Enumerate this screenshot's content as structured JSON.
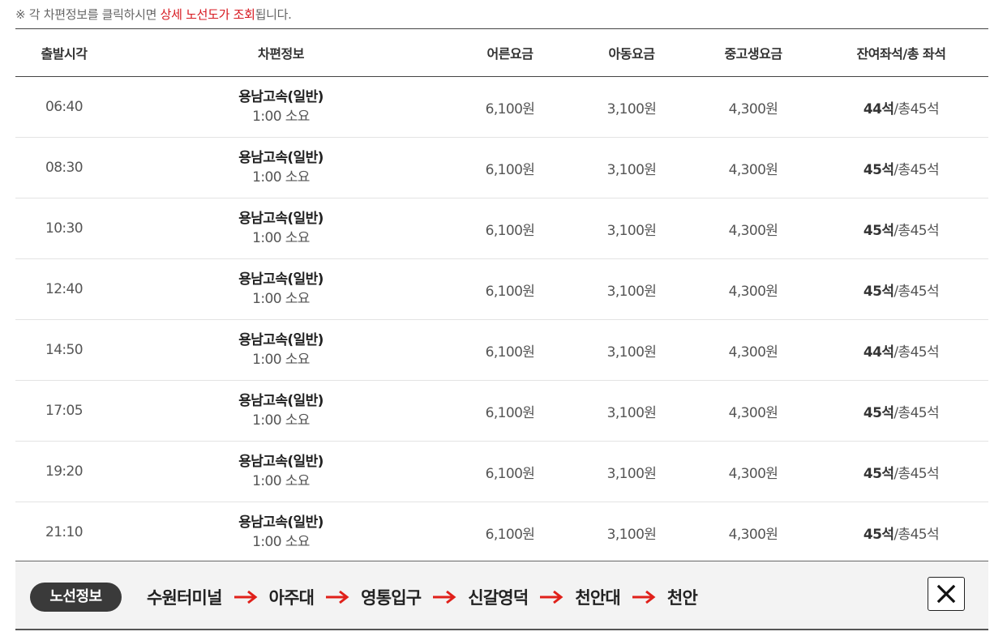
{
  "notice": {
    "prefix": "※ 각 차편정보를 클릭하시면 ",
    "highlight": "상세 노선도가 조회",
    "suffix": "됩니다."
  },
  "table": {
    "headers": [
      "출발시각",
      "차편정보",
      "어른요금",
      "아동요금",
      "중고생요금",
      "잔여좌석/총 좌석"
    ],
    "rows": [
      {
        "time": "06:40",
        "bus": "용남고속(일반)",
        "duration": "1:00 소요",
        "adult": "6,100원",
        "child": "3,100원",
        "student": "4,300원",
        "seats_left": "44석",
        "seats_total": "/총45석"
      },
      {
        "time": "08:30",
        "bus": "용남고속(일반)",
        "duration": "1:00 소요",
        "adult": "6,100원",
        "child": "3,100원",
        "student": "4,300원",
        "seats_left": "45석",
        "seats_total": "/총45석"
      },
      {
        "time": "10:30",
        "bus": "용남고속(일반)",
        "duration": "1:00 소요",
        "adult": "6,100원",
        "child": "3,100원",
        "student": "4,300원",
        "seats_left": "45석",
        "seats_total": "/총45석"
      },
      {
        "time": "12:40",
        "bus": "용남고속(일반)",
        "duration": "1:00 소요",
        "adult": "6,100원",
        "child": "3,100원",
        "student": "4,300원",
        "seats_left": "45석",
        "seats_total": "/총45석"
      },
      {
        "time": "14:50",
        "bus": "용남고속(일반)",
        "duration": "1:00 소요",
        "adult": "6,100원",
        "child": "3,100원",
        "student": "4,300원",
        "seats_left": "44석",
        "seats_total": "/총45석"
      },
      {
        "time": "17:05",
        "bus": "용남고속(일반)",
        "duration": "1:00 소요",
        "adult": "6,100원",
        "child": "3,100원",
        "student": "4,300원",
        "seats_left": "45석",
        "seats_total": "/총45석"
      },
      {
        "time": "19:20",
        "bus": "용남고속(일반)",
        "duration": "1:00 소요",
        "adult": "6,100원",
        "child": "3,100원",
        "student": "4,300원",
        "seats_left": "45석",
        "seats_total": "/총45석"
      },
      {
        "time": "21:10",
        "bus": "용남고속(일반)",
        "duration": "1:00 소요",
        "adult": "6,100원",
        "child": "3,100원",
        "student": "4,300원",
        "seats_left": "45석",
        "seats_total": "/총45석"
      }
    ]
  },
  "route": {
    "badge": "노선정보",
    "stops": [
      "수원터미널",
      "아주대",
      "영통입구",
      "신갈영덕",
      "천안대",
      "천안"
    ],
    "arrow_icon": "red-right-arrow-icon",
    "close_icon": "close-x-icon"
  },
  "colors": {
    "highlight": "#d71920",
    "arrow": "#e0201a",
    "badge_bg": "#3a3a3a",
    "route_bg": "#f3f3f3"
  }
}
